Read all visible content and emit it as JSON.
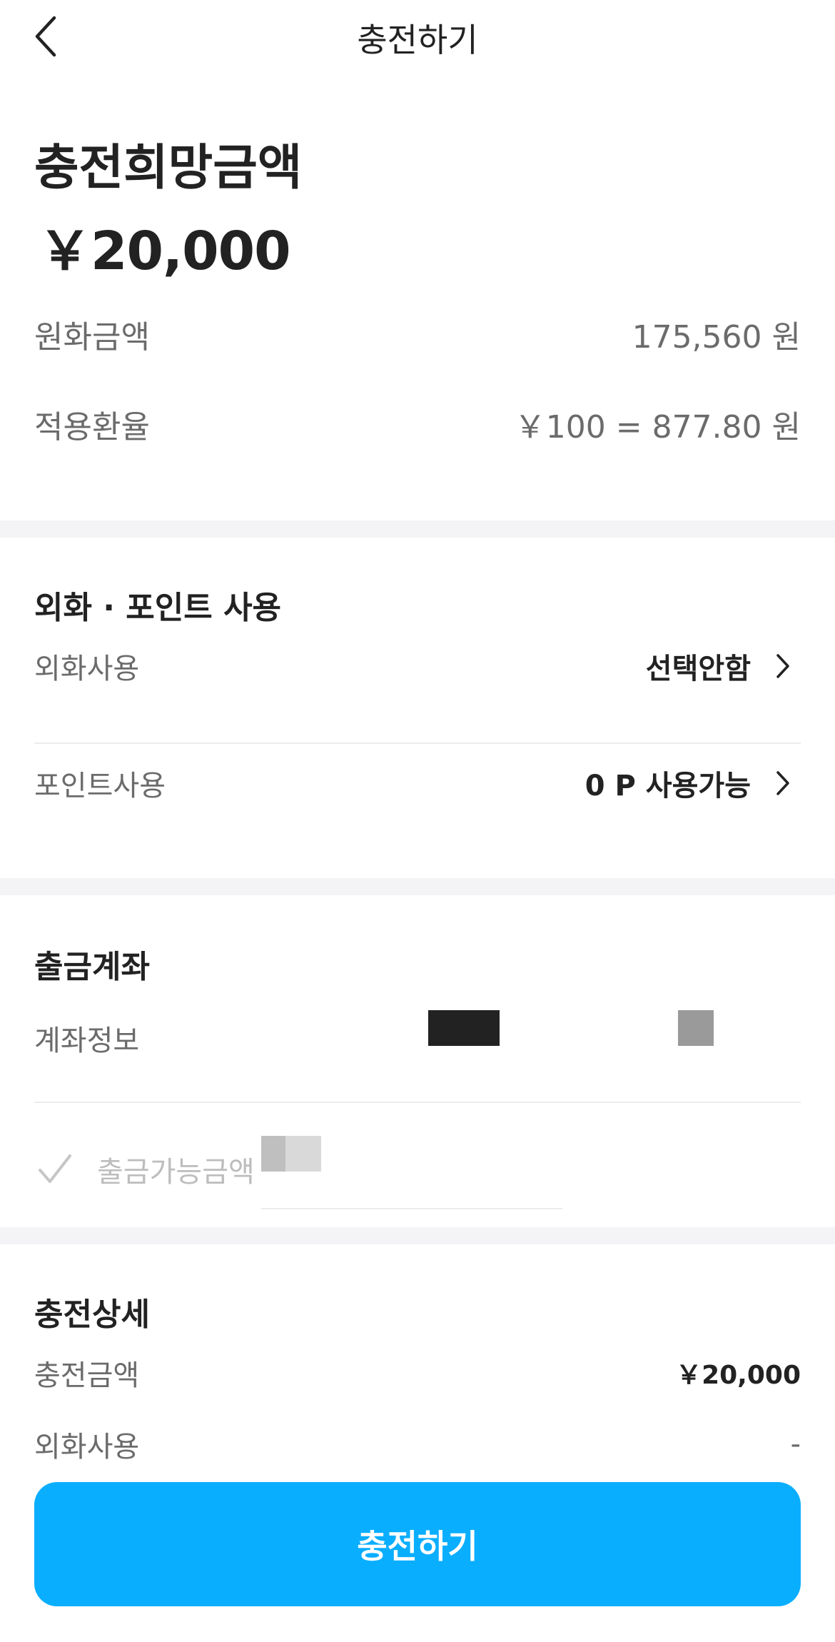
{
  "header": {
    "title": "충전하기"
  },
  "amount": {
    "label": "충전희망금액",
    "value": "￥20,000",
    "krw_label": "원화금액",
    "krw_value": "175,560 원",
    "rate_label": "적용환율",
    "rate_value": "￥100 = 877.80 원"
  },
  "usage": {
    "title": "외화 · 포인트 사용",
    "fx_label": "외화사용",
    "fx_value": "선택안함",
    "point_label": "포인트사용",
    "point_value": "0 P 사용가능"
  },
  "account": {
    "title": "출금계좌",
    "info_label": "계좌정보",
    "withdrawable_label": "출금가능금액"
  },
  "detail": {
    "title": "충전상세",
    "charge_label": "충전금액",
    "charge_value": "￥20,000",
    "fx_label": "외화사용",
    "fx_value": "-"
  },
  "cta": {
    "label": "충전하기",
    "color": "#0aaeff"
  }
}
